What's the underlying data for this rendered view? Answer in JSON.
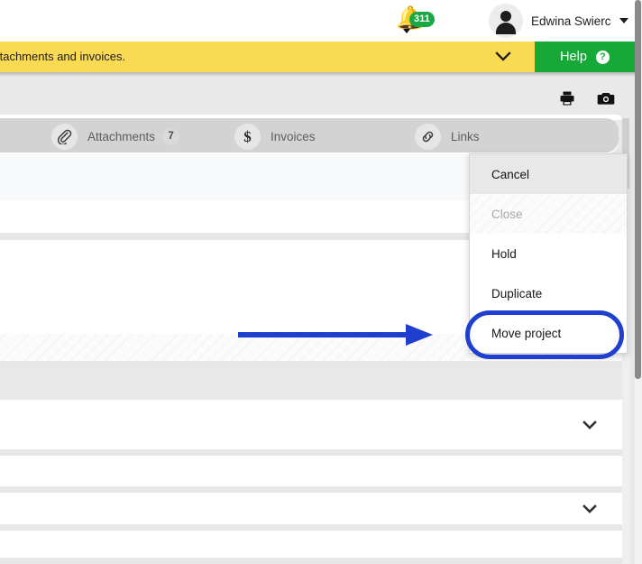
{
  "topbar": {
    "notifications": {
      "icon": "bell-icon",
      "badge_count": "311"
    },
    "user": {
      "name": "Edwina Swierc",
      "avatar_icon": "user-avatar-icon",
      "caret_icon": "caret-down-icon"
    }
  },
  "banner": {
    "message": "ttachments and invoices.",
    "expand_icon": "chevron-down-icon",
    "help_label": "Help",
    "help_icon": "question-mark-icon",
    "bg_color": "#fada53",
    "help_color": "#17a938"
  },
  "toolbar": {
    "print_icon": "printer-icon",
    "camera_icon": "camera-icon"
  },
  "tabs": [
    {
      "id": "attachments",
      "label": "Attachments",
      "icon": "paperclip-icon",
      "count": "7"
    },
    {
      "id": "invoices",
      "label": "Invoices",
      "icon": "dollar-sign-icon",
      "count": ""
    },
    {
      "id": "links",
      "label": "Links",
      "icon": "chain-link-icon",
      "count": ""
    }
  ],
  "menu": {
    "items": [
      {
        "label": "Cancel",
        "state": "active"
      },
      {
        "label": "Close",
        "state": "disabled"
      },
      {
        "label": "Hold",
        "state": "normal"
      },
      {
        "label": "Duplicate",
        "state": "normal"
      },
      {
        "label": "Move project",
        "state": "normal"
      }
    ]
  },
  "annotations": {
    "highlight_target": "Move project",
    "color": "#1f3fcf",
    "arrow_icon": "arrow-right-annotation",
    "circle_icon": "ellipse-highlight-annotation"
  },
  "panels": [
    {
      "id": "panel-1",
      "chevron": "chevron-down-icon"
    },
    {
      "id": "panel-2",
      "chevron": ""
    },
    {
      "id": "panel-3",
      "chevron": "chevron-down-icon"
    },
    {
      "id": "panel-4",
      "chevron": ""
    }
  ],
  "scrollbars": {
    "page_scrollbar": "vertical-scrollbar",
    "inner_scrollbar": "inner-vertical-scrollbar"
  }
}
